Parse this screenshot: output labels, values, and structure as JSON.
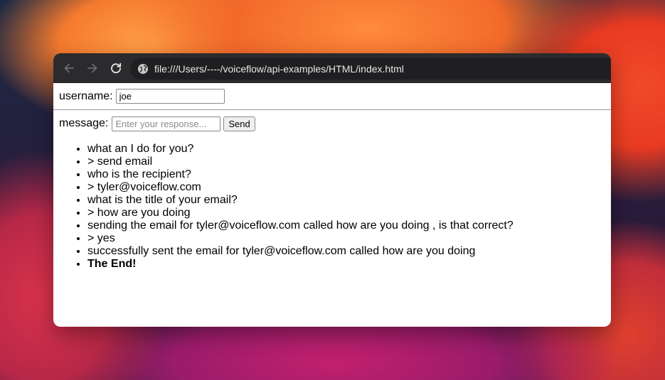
{
  "browser": {
    "url": "file:///Users/----/voiceflow/api-examples/HTML/index.html"
  },
  "form": {
    "username_label": "username:",
    "username_value": "joe",
    "message_label": "message:",
    "message_placeholder": "Enter your response...",
    "send_label": "Send"
  },
  "messages": [
    "what an I do for you?",
    "> send email",
    "who is the recipient?",
    "> tyler@voiceflow.com",
    "what is the title of your email?",
    "> how are you doing",
    "sending the email for tyler@voiceflow.com called how are you doing , is that correct?",
    "> yes",
    "successfully sent the email for tyler@voiceflow.com called how are you doing",
    "The End!"
  ],
  "colors": {
    "toolbar_bg": "#2b2b2d",
    "url_bar_bg": "#1f1f21",
    "url_text": "#e8e8e8"
  },
  "icons": {
    "back": "arrow-left-icon",
    "forward": "arrow-right-icon",
    "reload": "reload-icon",
    "site": "globe-icon"
  }
}
